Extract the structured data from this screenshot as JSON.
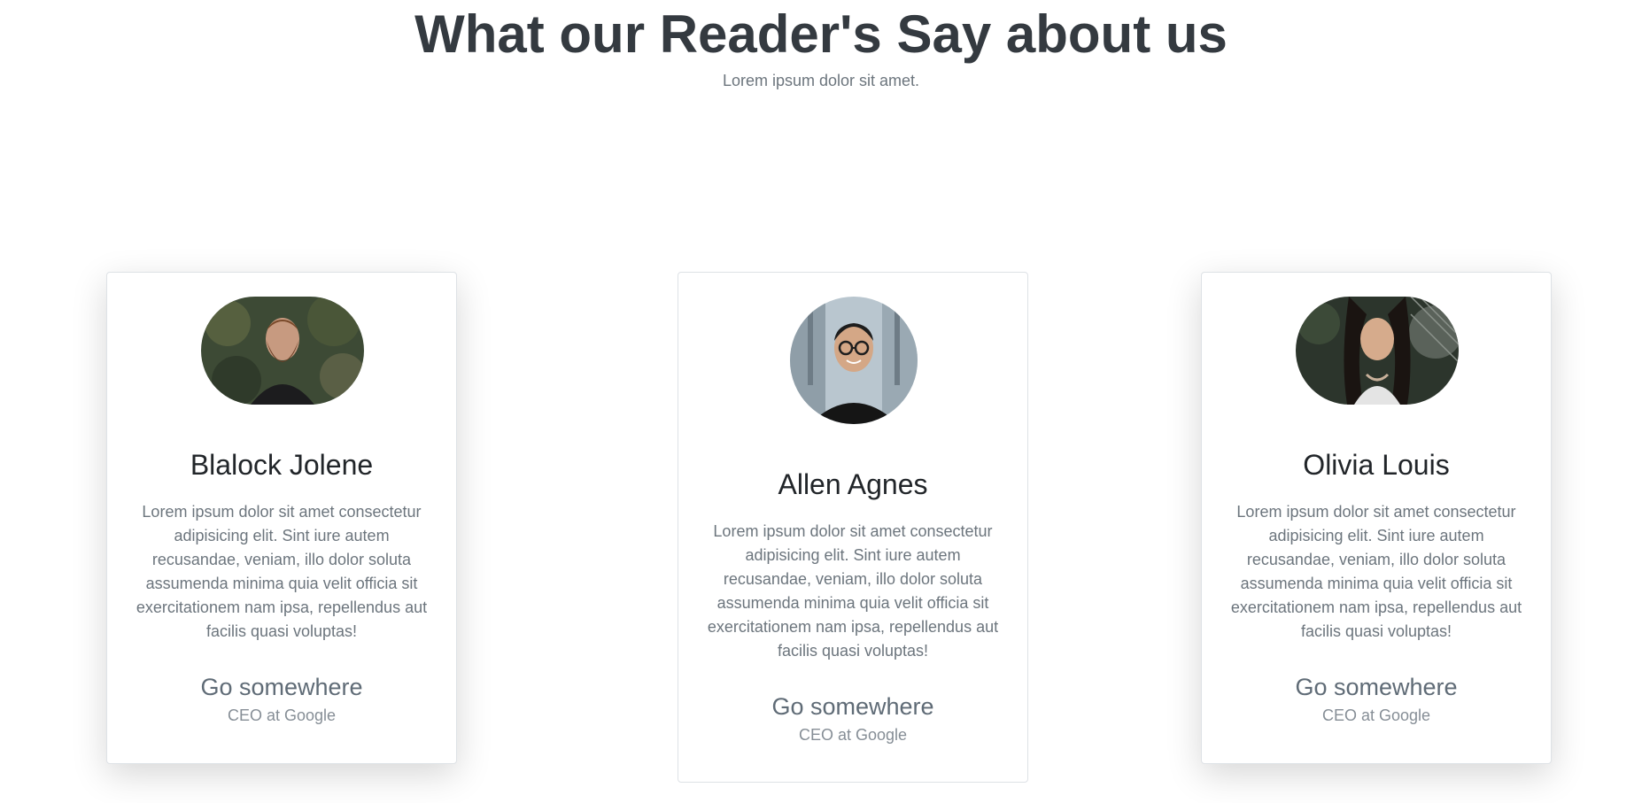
{
  "header": {
    "title": "What our Reader's Say about us",
    "subtitle": "Lorem ipsum dolor sit amet."
  },
  "testimonials": [
    {
      "name": "Blalock Jolene",
      "text": "Lorem ipsum dolor sit amet consectetur adipisicing elit. Sint iure autem recusandae, veniam, illo dolor soluta assumenda minima quia velit officia sit exercitationem nam ipsa, repellendus aut facilis quasi voluptas!",
      "link": "Go somewhere",
      "role": "CEO at Google",
      "avatar_icon": "avatar-photo-icon"
    },
    {
      "name": "Allen Agnes",
      "text": "Lorem ipsum dolor sit amet consectetur adipisicing elit. Sint iure autem recusandae, veniam, illo dolor soluta assumenda minima quia velit officia sit exercitationem nam ipsa, repellendus aut facilis quasi voluptas!",
      "link": "Go somewhere",
      "role": "CEO at Google",
      "avatar_icon": "avatar-photo-icon"
    },
    {
      "name": "Olivia Louis",
      "text": "Lorem ipsum dolor sit amet consectetur adipisicing elit. Sint iure autem recusandae, veniam, illo dolor soluta assumenda minima quia velit officia sit exercitationem nam ipsa, repellendus aut facilis quasi voluptas!",
      "link": "Go somewhere",
      "role": "CEO at Google",
      "avatar_icon": "avatar-photo-icon"
    }
  ],
  "colors": {
    "title": "#343a40",
    "muted": "#6c757d",
    "border": "#dee2e6"
  }
}
